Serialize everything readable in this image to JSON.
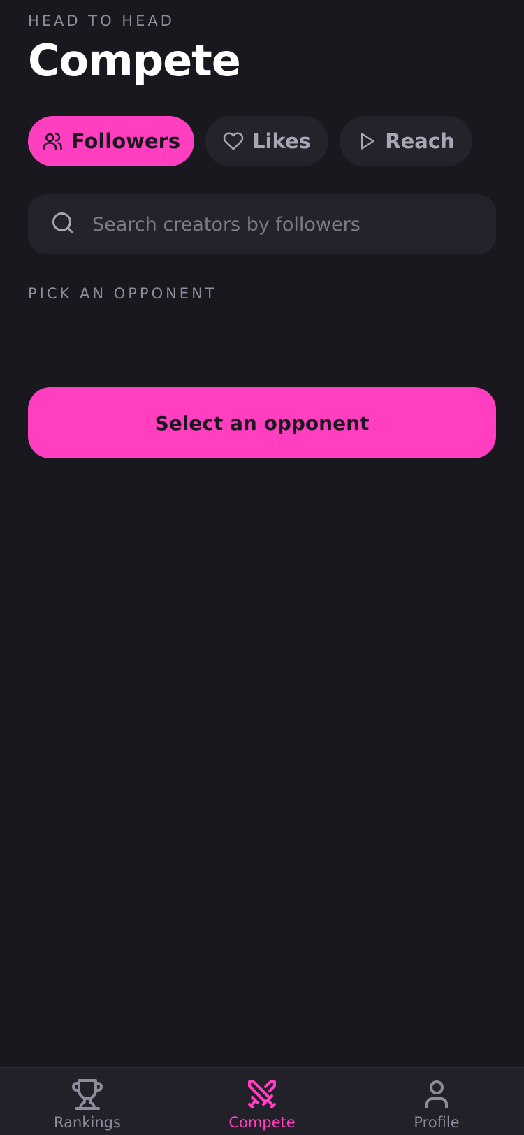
{
  "header": {
    "eyebrow": "HEAD TO HEAD",
    "title": "Compete"
  },
  "metrics": [
    {
      "label": "Followers",
      "icon": "users-icon",
      "active": true
    },
    {
      "label": "Likes",
      "icon": "heart-icon",
      "active": false
    },
    {
      "label": "Reach",
      "icon": "play-icon",
      "active": false
    }
  ],
  "search": {
    "placeholder": "Search creators by followers",
    "value": ""
  },
  "opponents": {
    "section_label": "PICK AN OPPONENT"
  },
  "cta": {
    "label": "Select an opponent"
  },
  "tabbar": {
    "items": [
      {
        "label": "Rankings",
        "icon": "trophy-icon",
        "active": false
      },
      {
        "label": "Compete",
        "icon": "swords-icon",
        "active": true
      },
      {
        "label": "Profile",
        "icon": "user-icon",
        "active": false
      }
    ]
  },
  "colors": {
    "background": "#19181f",
    "surface": "#24232c",
    "accent": "#ff3fbf",
    "muted": "#8f8c9b"
  }
}
